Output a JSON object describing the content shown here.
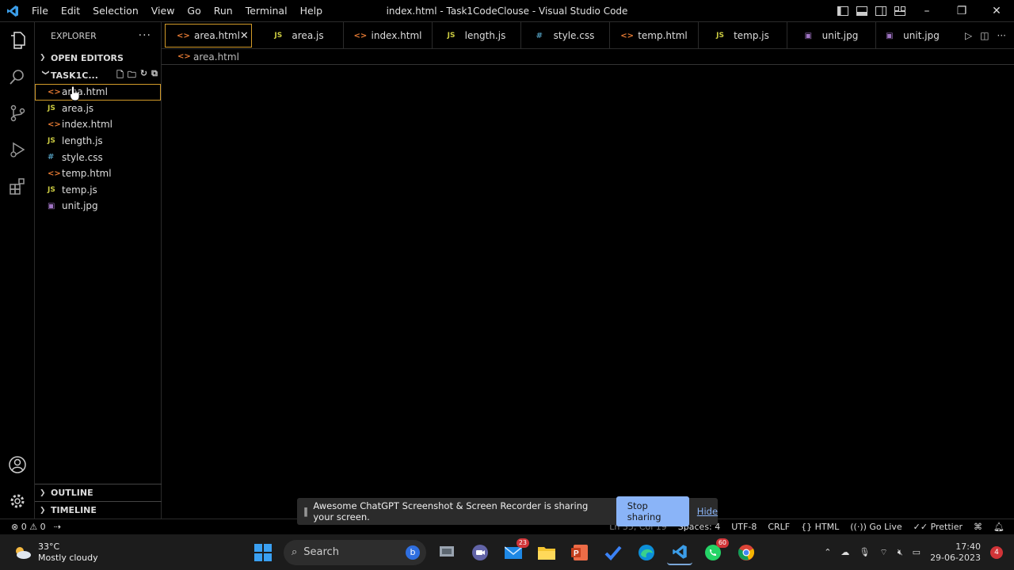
{
  "titlebar": {
    "title": "index.html - Task1CodeClouse - Visual Studio Code",
    "menu": [
      "File",
      "Edit",
      "Selection",
      "View",
      "Go",
      "Run",
      "Terminal",
      "Help"
    ]
  },
  "sidebar": {
    "header": "EXPLORER",
    "open_editors": "OPEN EDITORS",
    "project": "TASK1C...",
    "files": [
      {
        "name": "area.html",
        "type": "html"
      },
      {
        "name": "area.js",
        "type": "js"
      },
      {
        "name": "index.html",
        "type": "html"
      },
      {
        "name": "length.js",
        "type": "js"
      },
      {
        "name": "style.css",
        "type": "css"
      },
      {
        "name": "temp.html",
        "type": "html"
      },
      {
        "name": "temp.js",
        "type": "js"
      },
      {
        "name": "unit.jpg",
        "type": "img"
      }
    ],
    "outline": "OUTLINE",
    "timeline": "TIMELINE"
  },
  "tabs": [
    {
      "label": "area.html",
      "type": "html"
    },
    {
      "label": "area.js",
      "type": "js"
    },
    {
      "label": "index.html",
      "type": "html"
    },
    {
      "label": "length.js",
      "type": "js"
    },
    {
      "label": "style.css",
      "type": "css"
    },
    {
      "label": "temp.html",
      "type": "html"
    },
    {
      "label": "temp.js",
      "type": "js"
    },
    {
      "label": "unit.jpg",
      "type": "img"
    },
    {
      "label": "unit.jpg",
      "type": "img"
    }
  ],
  "breadcrumb": "area.html",
  "statusbar": {
    "errors": "0",
    "warnings": "0",
    "position": "Ln 35, Col 19",
    "spaces": "Spaces: 4",
    "encoding": "UTF-8",
    "eol": "CRLF",
    "language": "HTML",
    "golive": "Go Live",
    "prettier": "Prettier"
  },
  "share": {
    "message": "Awesome ChatGPT Screenshot & Screen Recorder is sharing your screen.",
    "stop": "Stop sharing",
    "hide": "Hide"
  },
  "taskbar": {
    "temp": "33°C",
    "weather": "Mostly cloudy",
    "search": "Search",
    "mail_badge": "23",
    "whatsapp_badge": "60",
    "time": "17:40",
    "date": "29-06-2023",
    "notifications": "4"
  },
  "colors": {
    "accent": "#d19a29",
    "html": "#e37933",
    "js": "#cbcb41",
    "css": "#519aba",
    "img": "#a074c4"
  }
}
